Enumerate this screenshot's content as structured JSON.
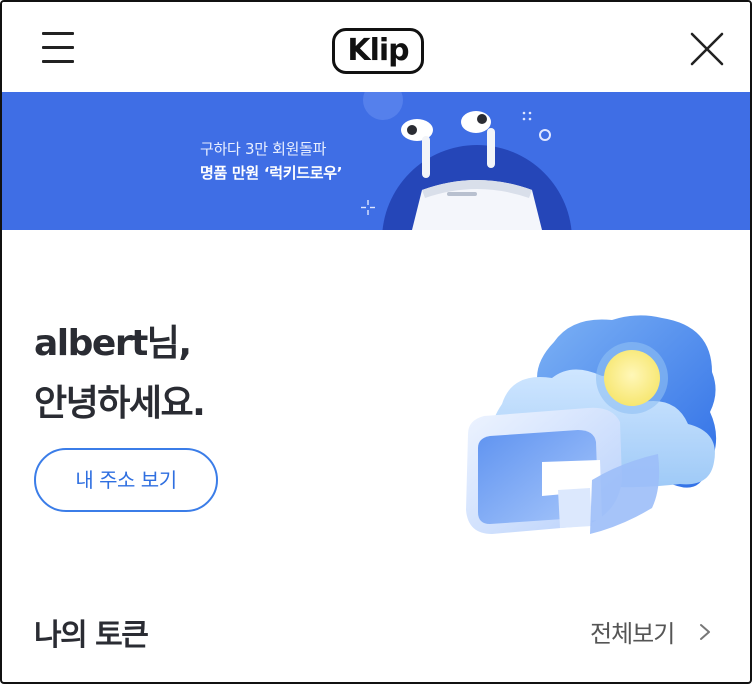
{
  "header": {
    "logo_text": "Klip",
    "menu_icon": "hamburger-icon",
    "close_icon": "close-icon"
  },
  "banner": {
    "line1": "구하다 3만 회원돌파",
    "line2": "명품 만원 ‘럭키드로우’",
    "background": "#3f6ee5",
    "image": "airpods-case-illustration"
  },
  "greeting": {
    "name_line": "albert님,",
    "hello_line": "안녕하세요."
  },
  "address_button": {
    "label": "내 주소 보기"
  },
  "tokens_section": {
    "title": "나의 토큰",
    "view_all_label": "전체보기",
    "chevron_icon": "chevron-right-icon"
  },
  "colors": {
    "accent": "#3b7de8",
    "text_dark": "#2a2c33"
  }
}
